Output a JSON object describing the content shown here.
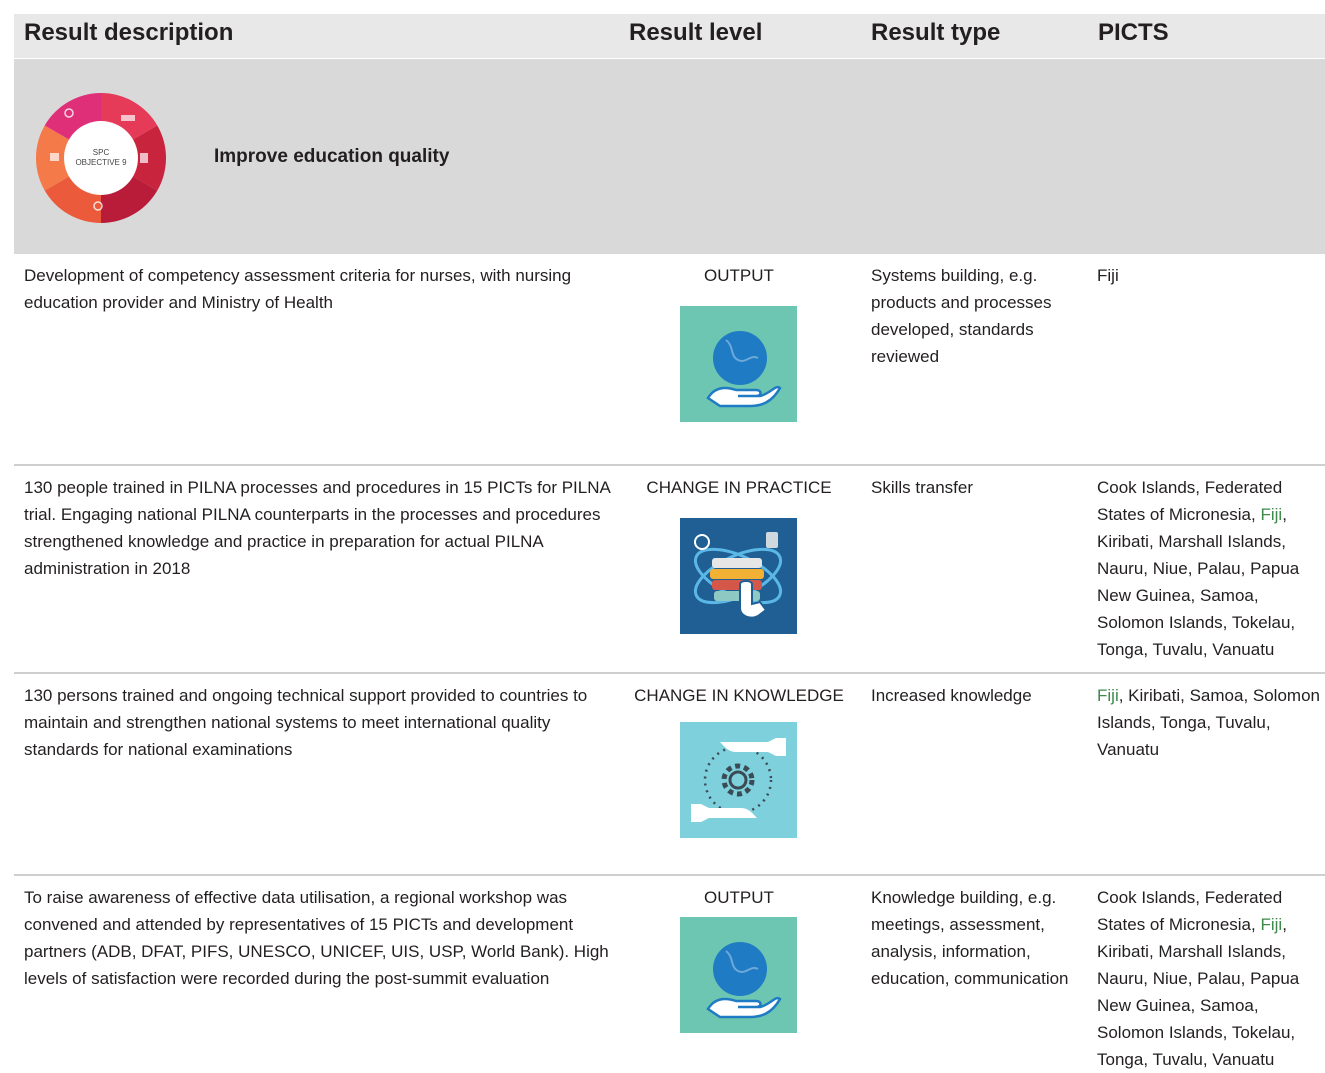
{
  "header": {
    "col_description": "Result description",
    "col_level": "Result level",
    "col_type": "Result type",
    "col_picts": "PICTS"
  },
  "objective": {
    "wheel_label_line1": "SPC",
    "wheel_label_line2": "OBJECTIVE 9",
    "title": "Improve education quality"
  },
  "rows": [
    {
      "description": "Development of competency assessment criteria for nurses, with nursing education provider and Ministry of Health",
      "level": "OUTPUT",
      "icon": "hand-globe-icon",
      "type": "Systems building, e.g. products and processes developed, standards reviewed",
      "picts_before": "",
      "picts_fiji": "",
      "picts_after": "Fiji"
    },
    {
      "description": "130 people trained in PILNA processes and procedures in 15 PICTs for PILNA trial. Engaging national PILNA counterparts in the processes and procedures strengthened knowledge and practice in preparation for actual PILNA administration in 2018",
      "level": "CHANGE IN PRACTICE",
      "icon": "books-touch-icon",
      "type": "Skills transfer",
      "picts_before": "Cook Islands, Federated States of Micronesia, ",
      "picts_fiji": "Fiji",
      "picts_after": ", Kiribati, Marshall Islands, Nauru, Niue, Palau, Papua New Guinea, Samoa, Solomon Islands, Tokelau, Tonga, Tuvalu, Vanuatu"
    },
    {
      "description": "130 persons trained and ongoing technical support provided to countries to maintain and strengthen national systems to meet international quality standards for national examinations",
      "level": "CHANGE IN KNOWLEDGE",
      "icon": "hands-gear-icon",
      "type": "Increased knowledge",
      "picts_before": "",
      "picts_fiji": "Fiji",
      "picts_after": ", Kiribati, Samoa, Solomon Islands, Tonga, Tuvalu, Vanuatu"
    },
    {
      "description": "To raise awareness of effective data utilisation, a regional workshop was convened and attended by representatives of 15 PICTs and development partners (ADB, DFAT, PIFS, UNESCO, UNICEF, UIS, USP, World Bank). High levels of satisfaction were recorded during the post-summit evaluation",
      "level": "OUTPUT",
      "icon": "hand-globe-icon",
      "type": "Knowledge building, e.g. meetings, assessment, analysis, information, education, communication",
      "picts_before": "Cook Islands, Federated States of Micronesia, ",
      "picts_fiji": "Fiji",
      "picts_after": ", Kiribati, Marshall Islands, Nauru, Niue, Palau, Papua New Guinea, Samoa, Solomon Islands, Tokelau, Tonga, Tuvalu, Vanuatu"
    }
  ],
  "colors": {
    "header_bg": "#e8e8e9",
    "objective_bg": "#d9d9da",
    "fiji_link": "#3d8a4b",
    "output_icon_bg": "#6cc6b1",
    "practice_icon_bg": "#1f5f94",
    "knowledge_icon_bg": "#7dd0dc"
  }
}
